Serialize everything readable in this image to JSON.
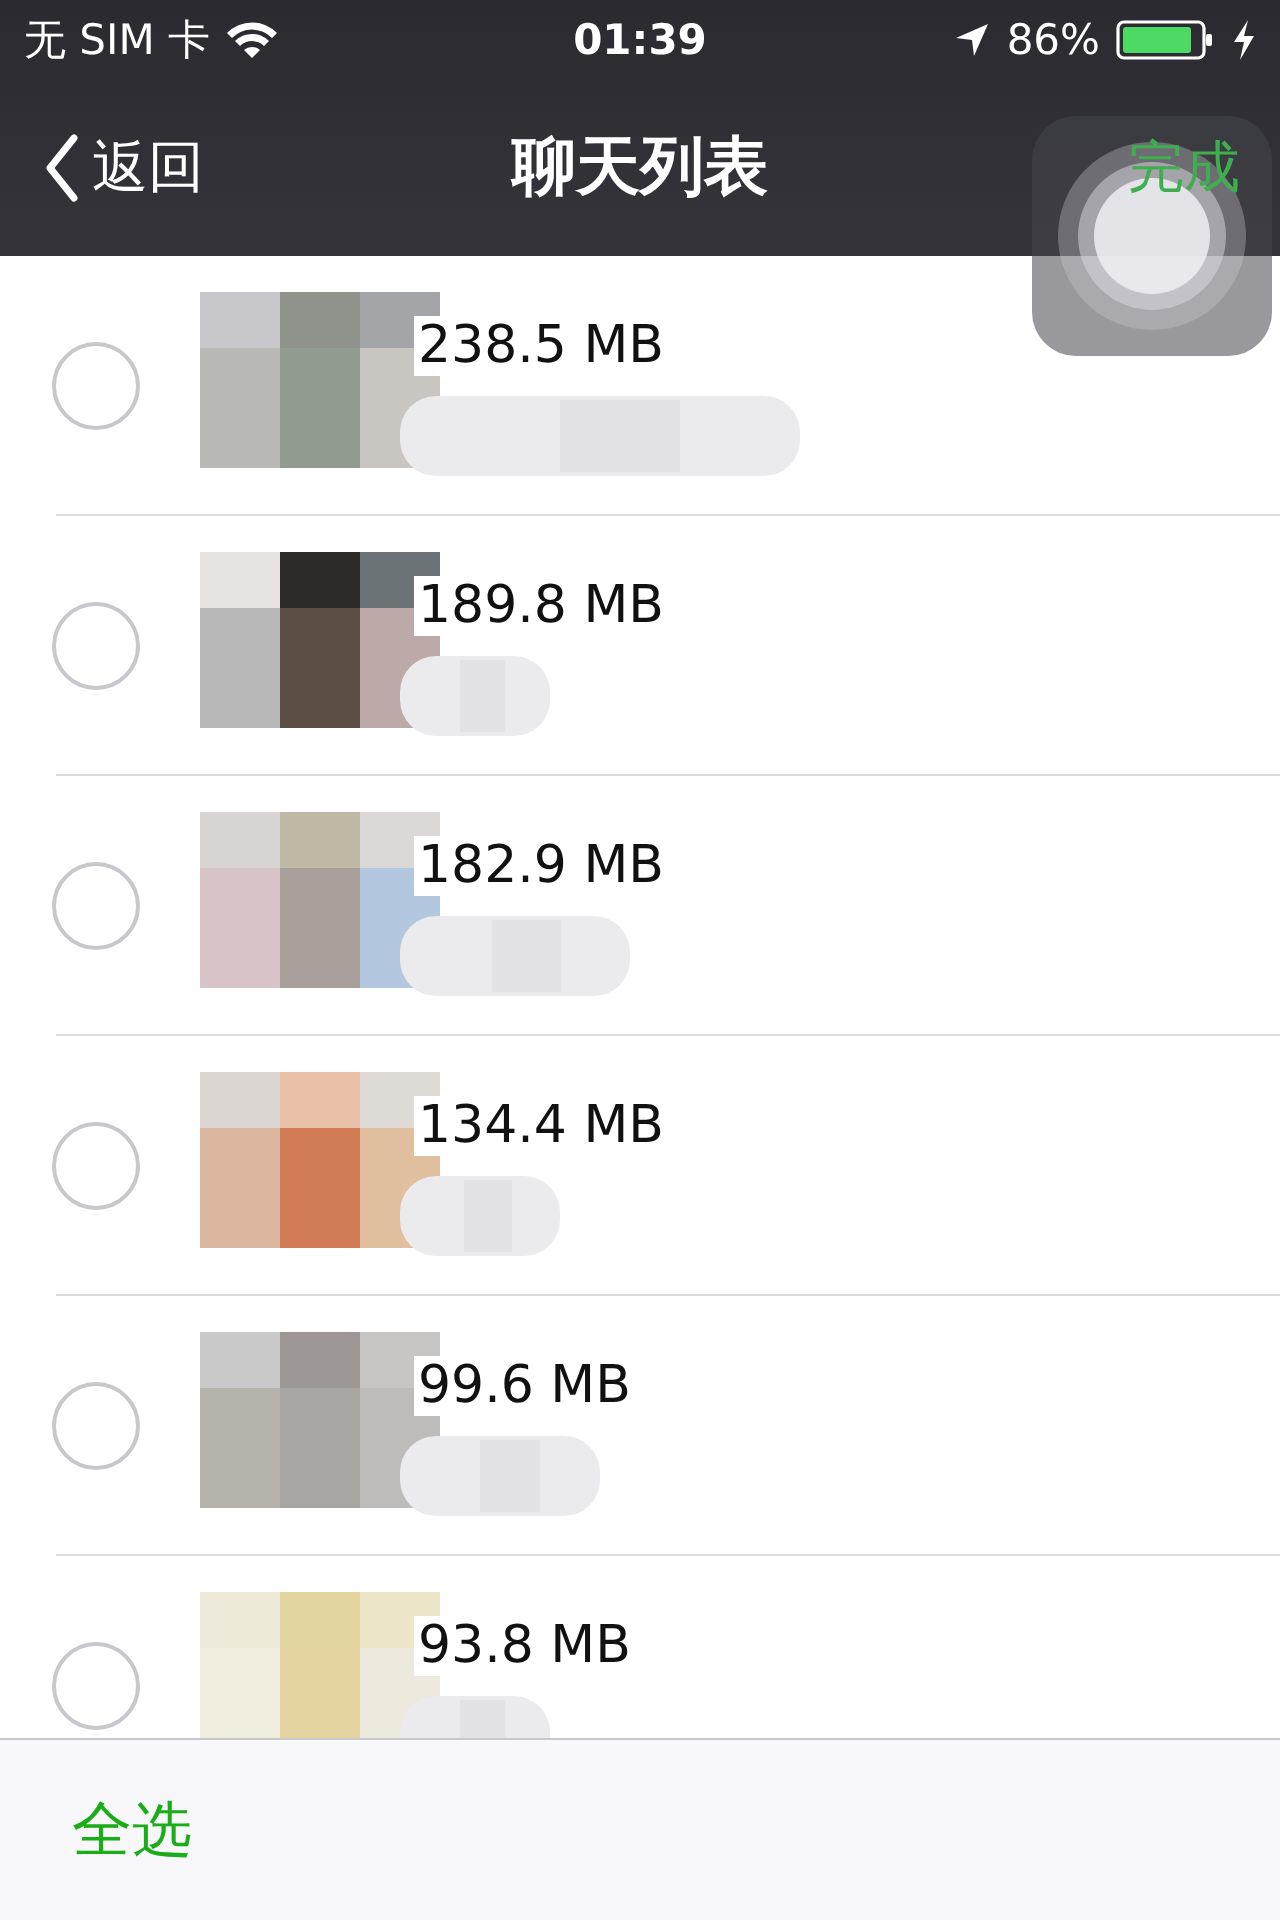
{
  "status_bar": {
    "carrier": "无 SIM 卡",
    "time": "01:39",
    "battery": "86%"
  },
  "nav": {
    "back": "返回",
    "title": "聊天列表",
    "done": "完成"
  },
  "rows": [
    {
      "size": "238.5 MB",
      "selected": false
    },
    {
      "size": "189.8 MB",
      "selected": false
    },
    {
      "size": "182.9 MB",
      "selected": false
    },
    {
      "size": "134.4 MB",
      "selected": false
    },
    {
      "size": "99.6 MB",
      "selected": false
    },
    {
      "size": "93.8 MB",
      "selected": false
    }
  ],
  "toolbar": {
    "select_all": "全选"
  }
}
